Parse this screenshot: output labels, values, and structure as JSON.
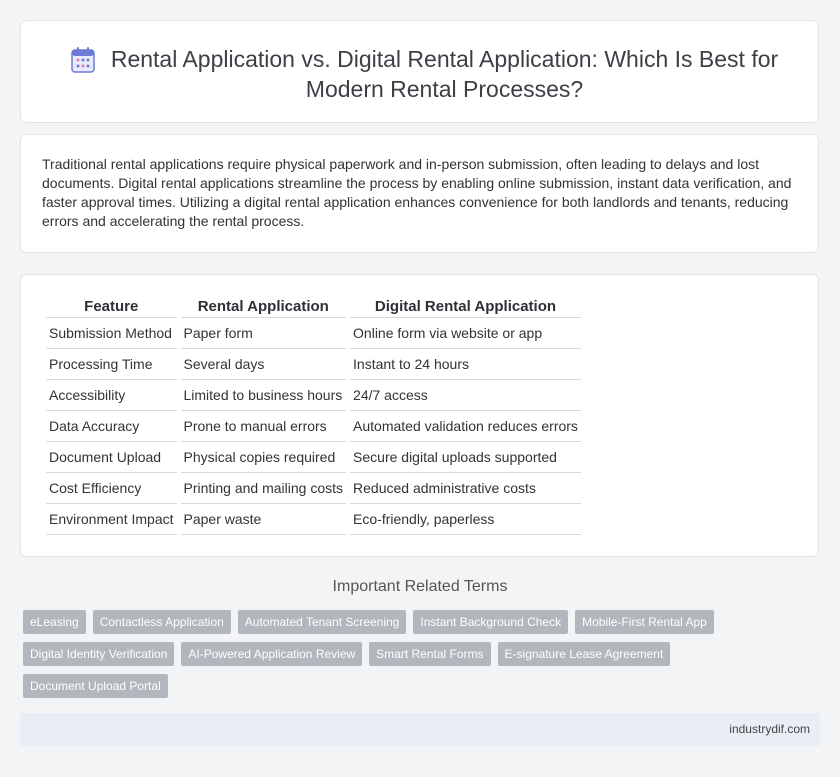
{
  "header": {
    "title": "Rental Application vs. Digital Rental Application: Which Is Best for Modern Rental Processes?",
    "icon": "calendar-icon"
  },
  "intro": {
    "text": "Traditional rental applications require physical paperwork and in-person submission, often leading to delays and lost documents. Digital rental applications streamline the process by enabling online submission, instant data verification, and faster approval times. Utilizing a digital rental application enhances convenience for both landlords and tenants, reducing errors and accelerating the rental process."
  },
  "table": {
    "headers": [
      "Feature",
      "Rental Application",
      "Digital Rental Application"
    ],
    "rows": [
      [
        "Submission Method",
        "Paper form",
        "Online form via website or app"
      ],
      [
        "Processing Time",
        "Several days",
        "Instant to 24 hours"
      ],
      [
        "Accessibility",
        "Limited to business hours",
        "24/7 access"
      ],
      [
        "Data Accuracy",
        "Prone to manual errors",
        "Automated validation reduces errors"
      ],
      [
        "Document Upload",
        "Physical copies required",
        "Secure digital uploads supported"
      ],
      [
        "Cost Efficiency",
        "Printing and mailing costs",
        "Reduced administrative costs"
      ],
      [
        "Environment Impact",
        "Paper waste",
        "Eco-friendly, paperless"
      ]
    ]
  },
  "related": {
    "title": "Important Related Terms",
    "tags": [
      "eLeasing",
      "Contactless Application",
      "Automated Tenant Screening",
      "Instant Background Check",
      "Mobile-First Rental App",
      "Digital Identity Verification",
      "AI-Powered Application Review",
      "Smart Rental Forms",
      "E-signature Lease Agreement",
      "Document Upload Portal"
    ]
  },
  "footer": {
    "site": "industrydif.com"
  },
  "colors": {
    "icon_accent": "#6c7bd6",
    "tag_bg": "#b2b6bd",
    "footer_bg": "#e9edf5"
  }
}
